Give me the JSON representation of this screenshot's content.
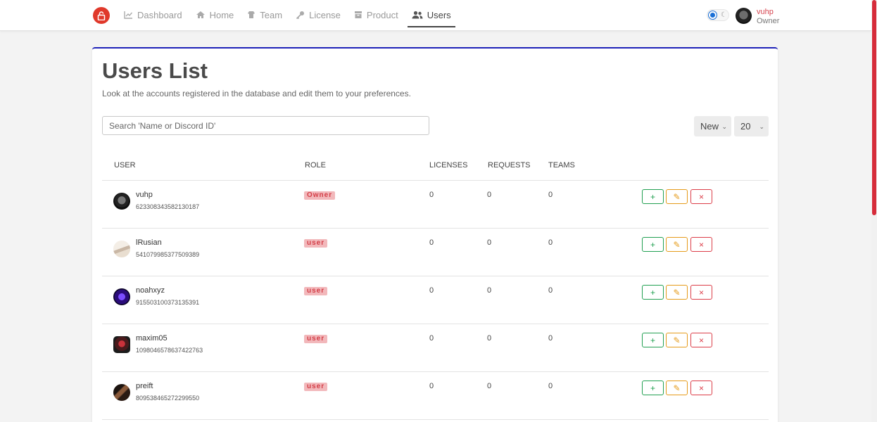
{
  "nav": {
    "items": [
      {
        "label": "Dashboard",
        "icon": "chart-line-icon"
      },
      {
        "label": "Home",
        "icon": "home-icon"
      },
      {
        "label": "Team",
        "icon": "team-icon"
      },
      {
        "label": "License",
        "icon": "key-icon"
      },
      {
        "label": "Product",
        "icon": "box-icon"
      },
      {
        "label": "Users",
        "icon": "users-icon",
        "active": true
      }
    ],
    "user": {
      "name": "vuhp",
      "role": "Owner"
    },
    "colors": {
      "brand": "#e0392b",
      "accent": "#1f22b8",
      "danger": "#dc3d48",
      "success": "#22a052",
      "warning": "#e59b1a"
    }
  },
  "page": {
    "title": "Users List",
    "subtitle": "Look at the accounts registered in the database and edit them to your preferences.",
    "search_placeholder": "Search 'Name or Discord ID'",
    "sort_value": "New",
    "page_size": "20"
  },
  "table": {
    "headers": {
      "user": "USER",
      "role": "ROLE",
      "licenses": "LICENSES",
      "requests": "REQUESTS",
      "teams": "TEAMS"
    },
    "rows": [
      {
        "name": "vuhp",
        "id": "623308343582130187",
        "role": "Owner",
        "licenses": "0",
        "requests": "0",
        "teams": "0"
      },
      {
        "name": "lRusian",
        "id": "541079985377509389",
        "role": "user",
        "licenses": "0",
        "requests": "0",
        "teams": "0"
      },
      {
        "name": "noahxyz",
        "id": "915503100373135391",
        "role": "user",
        "licenses": "0",
        "requests": "0",
        "teams": "0"
      },
      {
        "name": "maxim05",
        "id": "1098046578637422763",
        "role": "user",
        "licenses": "0",
        "requests": "0",
        "teams": "0"
      },
      {
        "name": "preift",
        "id": "809538465272299550",
        "role": "user",
        "licenses": "0",
        "requests": "0",
        "teams": "0"
      }
    ],
    "actions": {
      "add": "+",
      "edit": "✎",
      "delete": "×"
    }
  }
}
